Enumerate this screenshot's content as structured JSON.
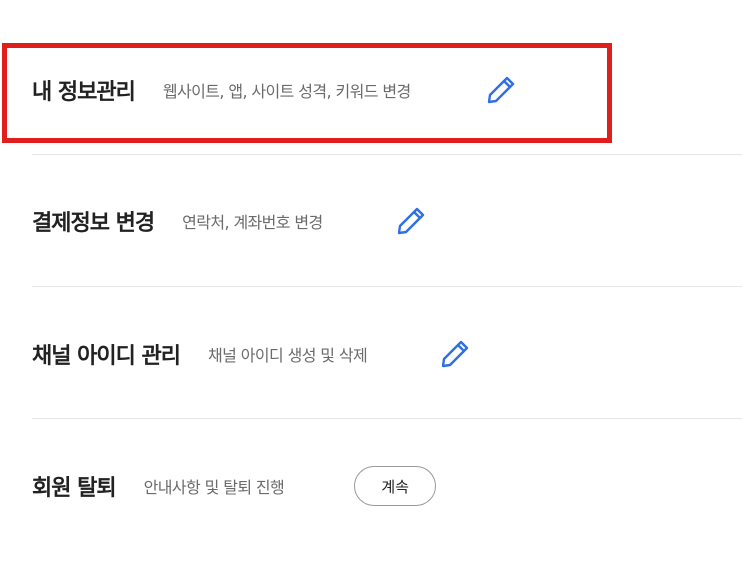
{
  "sections": [
    {
      "title": "내 정보관리",
      "description": "웹사이트, 앱, 사이트 성격, 키워드 변경",
      "action_icon": "pencil-icon"
    },
    {
      "title": "결제정보 변경",
      "description": "연락처, 계좌번호 변경",
      "action_icon": "pencil-icon"
    },
    {
      "title": "채널 아이디 관리",
      "description": "채널 아이디 생성 및 삭제",
      "action_icon": "pencil-icon"
    },
    {
      "title": "회원 탈퇴",
      "description": "안내사항 및 탈퇴 진행",
      "action_label": "계속"
    }
  ],
  "colors": {
    "highlight_border": "#e01e1e",
    "pencil_icon": "#2f6fe4",
    "title_text": "#222222",
    "description_text": "#6b6b6b",
    "divider": "#e6e6e6"
  }
}
